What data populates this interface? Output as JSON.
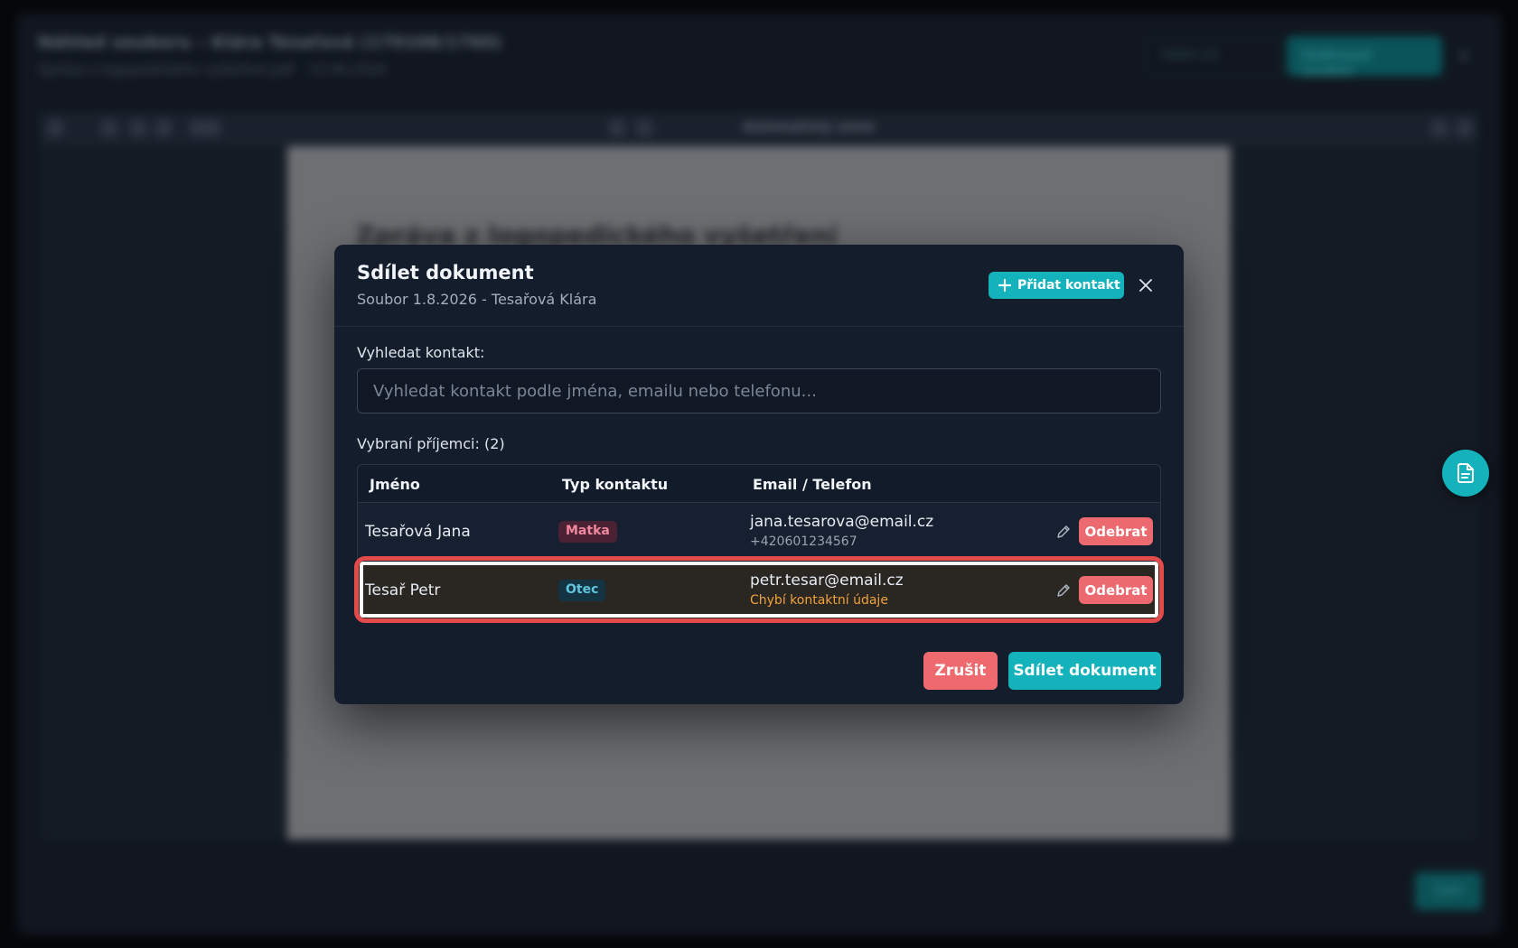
{
  "background": {
    "window_title": "Náhled souboru – Klára Tesařová (170108/1760)",
    "file_name": "Zpráva z logopedického vyšetření.pdf",
    "file_date": "13.06.2026",
    "header_secondary_button": "Sdílet (2)",
    "header_primary_button": "Stáhnout soubor",
    "zoom_label": "Automatický zoom",
    "page_heading": "Zpráva z logopedického vyšetření",
    "footer_button": "Zpět"
  },
  "modal": {
    "title": "Sdílet dokument",
    "subtitle": "Soubor 1.8.2026 - Tesařová Klára",
    "add_contact_label": "Přidat kontakt",
    "search_label": "Vyhledat kontakt:",
    "search_placeholder": "Vyhledat kontakt podle jména, emailu nebo telefonu...",
    "search_value": "",
    "recipients_label": "Vybraní příjemci: (2)",
    "table": {
      "columns": [
        "Jméno",
        "Typ kontaktu",
        "Email / Telefon"
      ],
      "rows": [
        {
          "name": "Tesařová Jana",
          "type": "Matka",
          "email": "jana.tesarova@email.cz",
          "phone": "+420601234567",
          "remove_label": "Odebrat"
        },
        {
          "name": "Tesař Petr",
          "type": "Otec",
          "email": "petr.tesar@email.cz",
          "warning": "Chybí kontaktní údaje",
          "remove_label": "Odebrat"
        }
      ]
    },
    "cancel_label": "Zrušit",
    "share_label": "Sdílet dokument"
  },
  "colors": {
    "accent": "#14b2bb",
    "danger": "#ec6a6f",
    "warning": "#f0a23c",
    "modal_bg": "#141d2c"
  },
  "icons": {
    "add": "plus-icon",
    "close": "close-icon",
    "edit": "pencil-icon",
    "fab": "document-icon"
  }
}
